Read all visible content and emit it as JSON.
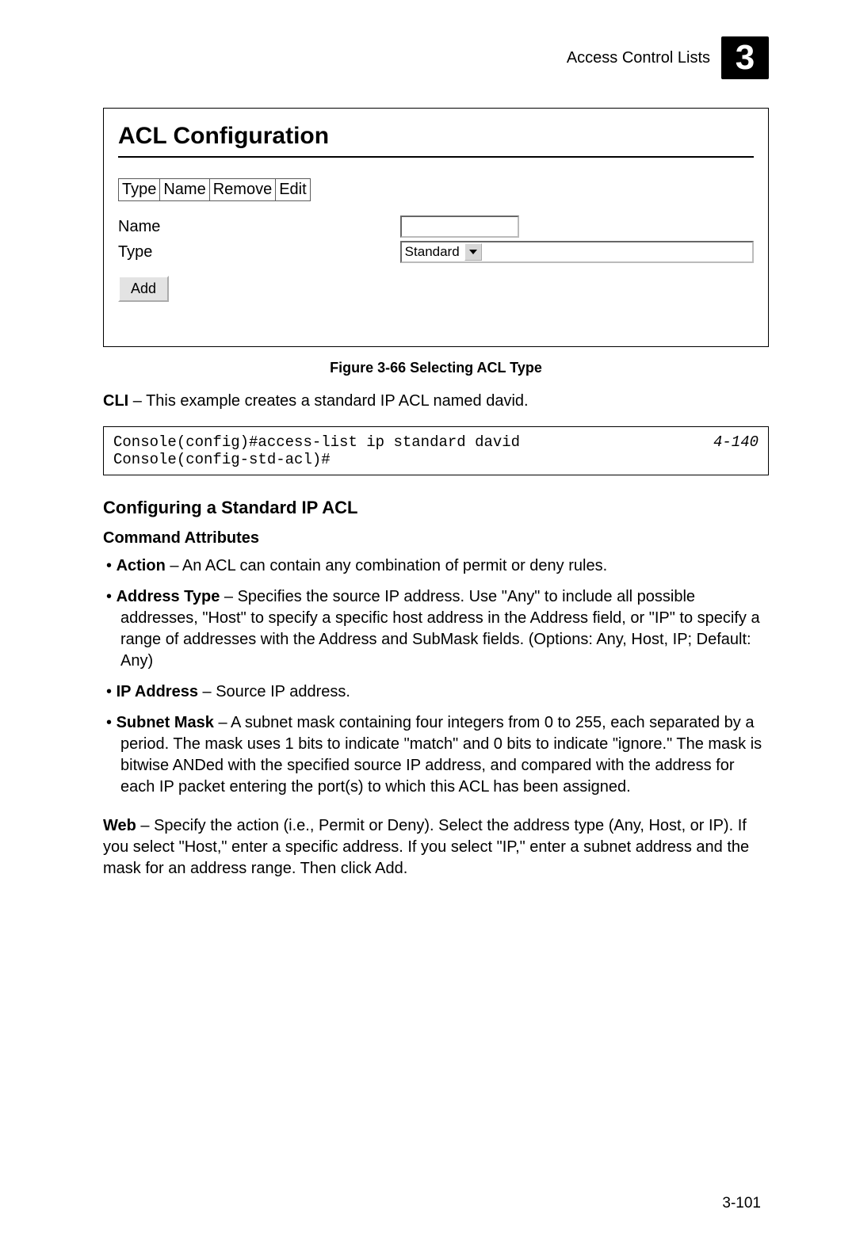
{
  "header": {
    "title": "Access Control Lists",
    "chapter": "3"
  },
  "figure": {
    "panel_title": "ACL Configuration",
    "table_headers": [
      "Type",
      "Name",
      "Remove",
      "Edit"
    ],
    "form": {
      "name_label": "Name",
      "name_value": "",
      "type_label": "Type",
      "type_value": "Standard"
    },
    "add_button": "Add",
    "caption": "Figure 3-66  Selecting ACL Type"
  },
  "cli_intro": {
    "prefix": "CLI",
    "text": " – This example creates a standard IP ACL named david."
  },
  "cli_box": {
    "lines": "Console(config)#access-list ip standard david\nConsole(config-std-acl)#",
    "ref": "4-140"
  },
  "section_title": "Configuring a Standard IP ACL",
  "command_attrs_title": "Command Attributes",
  "attrs": [
    {
      "term": "Action",
      "desc": " – An ACL can contain any combination of permit or deny rules."
    },
    {
      "term": "Address Type",
      "desc": " – Specifies the source IP address. Use \"Any\" to include all possible addresses, \"Host\" to specify a specific host address in the Address field, or \"IP\" to specify a range of addresses with the Address and SubMask fields. (Options: Any, Host, IP; Default: Any)"
    },
    {
      "term": "IP Address",
      "desc": " – Source IP address."
    },
    {
      "term": "Subnet Mask",
      "desc": " – A subnet mask containing four integers from 0 to 255, each separated by a period. The mask uses 1 bits to indicate \"match\" and 0 bits to indicate \"ignore.\" The mask is bitwise ANDed with the specified source IP address, and compared with the address for each IP packet entering the port(s) to which this ACL has been assigned."
    }
  ],
  "web_para": {
    "prefix": "Web",
    "text": " – Specify the action (i.e., Permit or Deny). Select the address type (Any, Host, or IP). If you select \"Host,\" enter a specific address. If you select \"IP,\" enter a subnet address and the mask for an address range. Then click Add."
  },
  "page_number": "3-101"
}
